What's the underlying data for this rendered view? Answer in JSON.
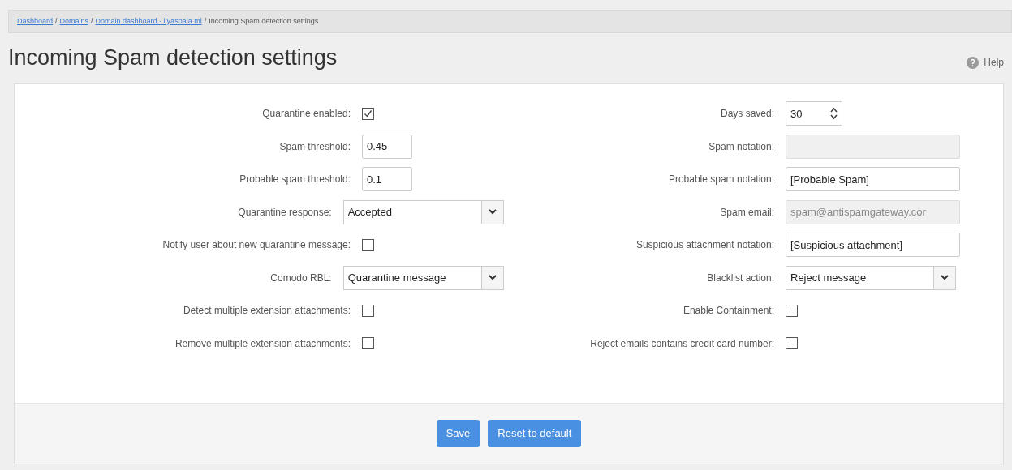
{
  "breadcrumb": [
    {
      "label": "Dashboard",
      "link": true
    },
    {
      "label": "Domains",
      "link": true
    },
    {
      "label": "Domain dashboard - ilyasoala.ml",
      "link": true
    },
    {
      "label": "Incoming Spam detection settings",
      "link": false
    }
  ],
  "breadcrumb_separator": "/",
  "title": "Incoming Spam detection settings",
  "help": {
    "label": "Help"
  },
  "left": [
    {
      "kind": "checkbox",
      "label": "Quarantine enabled:",
      "checked": true
    },
    {
      "kind": "short-text",
      "label": "Spam threshold:",
      "value": "0.45",
      "disabled": false
    },
    {
      "kind": "short-text",
      "label": "Probable spam threshold:",
      "value": "0.1",
      "disabled": false
    },
    {
      "kind": "select",
      "label": "Quarantine response:",
      "value": "Accepted"
    },
    {
      "kind": "checkbox",
      "label": "Notify user about new quarantine message:",
      "checked": false
    },
    {
      "kind": "select",
      "label": "Comodo RBL:",
      "value": "Quarantine message"
    },
    {
      "kind": "checkbox",
      "label": "Detect multiple extension attachments:",
      "checked": false
    },
    {
      "kind": "checkbox",
      "label": "Remove multiple extension attachments:",
      "checked": false
    }
  ],
  "right": [
    {
      "kind": "number",
      "label": "Days saved:",
      "value": "30"
    },
    {
      "kind": "text",
      "label": "Spam notation:",
      "disabled": true
    },
    {
      "kind": "text",
      "label": "Probable spam notation:",
      "value": "[Probable Spam]",
      "disabled": false
    },
    {
      "kind": "text",
      "label": "Spam email:",
      "value": "spam@antispamgateway.cor",
      "disabled": true
    },
    {
      "kind": "text",
      "label": "Suspicious attachment notation:",
      "value": "[Suspicious attachment]",
      "disabled": false
    },
    {
      "kind": "select",
      "label": "Blacklist action:",
      "value": "Reject message"
    },
    {
      "kind": "checkbox",
      "label": "Enable Containment:",
      "checked": false
    },
    {
      "kind": "checkbox",
      "label": "Reject emails contains credit card number:",
      "checked": false
    }
  ],
  "buttons": [
    "Save",
    "Reset to default"
  ]
}
